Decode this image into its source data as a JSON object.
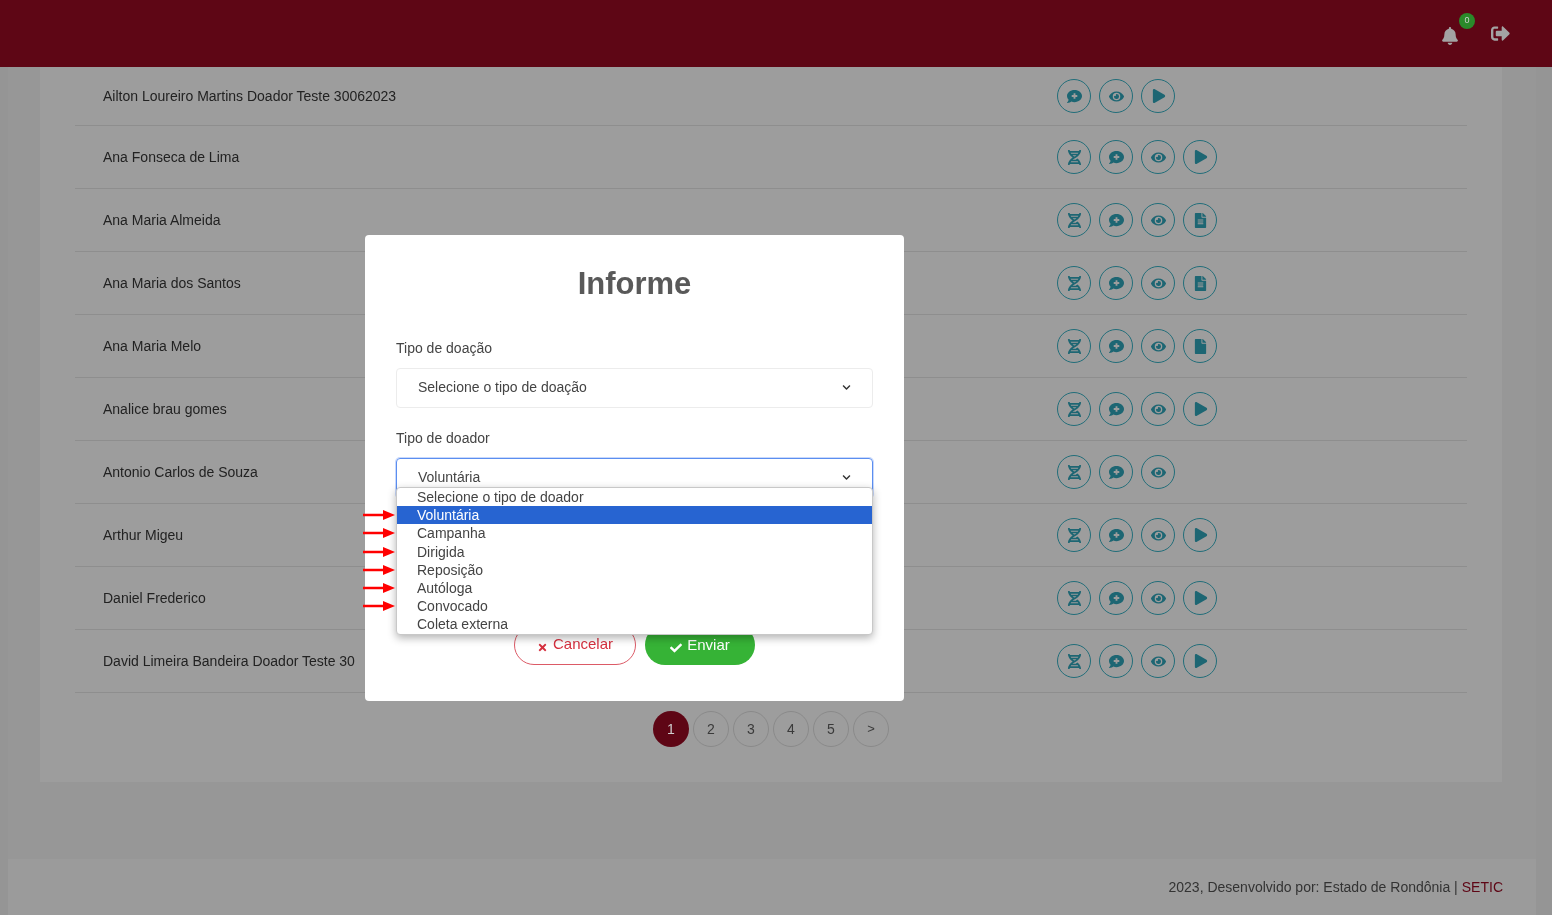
{
  "header": {
    "notification_count": "0"
  },
  "rows": [
    {
      "name": "Ailton Loureiro Martins Doador Teste 30062023",
      "actions": [
        {
          "kind": "comment"
        },
        {
          "kind": "view"
        },
        {
          "kind": "play"
        }
      ]
    },
    {
      "name": "Ana Fonseca de Lima",
      "actions": [
        {
          "kind": "dna"
        },
        {
          "kind": "comment"
        },
        {
          "kind": "view"
        },
        {
          "kind": "play"
        }
      ]
    },
    {
      "name": "Ana Maria Almeida",
      "actions": [
        {
          "kind": "dna"
        },
        {
          "kind": "comment"
        },
        {
          "kind": "view"
        },
        {
          "kind": "document"
        }
      ]
    },
    {
      "name": "Ana Maria dos Santos",
      "actions": [
        {
          "kind": "dna"
        },
        {
          "kind": "comment"
        },
        {
          "kind": "view"
        },
        {
          "kind": "document"
        }
      ]
    },
    {
      "name": "Ana Maria Melo",
      "actions": [
        {
          "kind": "dna"
        },
        {
          "kind": "comment"
        },
        {
          "kind": "view"
        },
        {
          "kind": "file"
        }
      ]
    },
    {
      "name": "Analice brau gomes",
      "actions": [
        {
          "kind": "dna"
        },
        {
          "kind": "comment"
        },
        {
          "kind": "view"
        },
        {
          "kind": "play"
        }
      ]
    },
    {
      "name": "Antonio Carlos de Souza",
      "actions": [
        {
          "kind": "dna"
        },
        {
          "kind": "comment"
        },
        {
          "kind": "view"
        }
      ]
    },
    {
      "name": "Arthur Migeu",
      "actions": [
        {
          "kind": "dna"
        },
        {
          "kind": "comment"
        },
        {
          "kind": "view"
        },
        {
          "kind": "play"
        }
      ]
    },
    {
      "name": "Daniel Frederico",
      "actions": [
        {
          "kind": "dna"
        },
        {
          "kind": "comment"
        },
        {
          "kind": "view"
        },
        {
          "kind": "play"
        }
      ]
    },
    {
      "name": "David Limeira Bandeira Doador Teste 30",
      "actions": [
        {
          "kind": "dna"
        },
        {
          "kind": "comment"
        },
        {
          "kind": "view"
        },
        {
          "kind": "play"
        }
      ]
    }
  ],
  "pagination": {
    "pages": [
      {
        "label": "1",
        "selected": true
      },
      {
        "label": "2",
        "selected": false
      },
      {
        "label": "3",
        "selected": false
      },
      {
        "label": "4",
        "selected": false
      },
      {
        "label": "5",
        "selected": false
      }
    ],
    "next": ">"
  },
  "modal": {
    "title": "Informe",
    "fields": [
      {
        "label": "Tipo de doação",
        "value": "Selecione o tipo de doação",
        "focused": false
      },
      {
        "label": "Tipo de doador",
        "value": "Voluntária",
        "focused": true
      }
    ],
    "dropdown_options": [
      {
        "label": "Selecione o tipo de doador",
        "selected": false,
        "marked": false
      },
      {
        "label": "Voluntária",
        "selected": true,
        "marked": true
      },
      {
        "label": "Campanha",
        "selected": false,
        "marked": true
      },
      {
        "label": "Dirigida",
        "selected": false,
        "marked": true
      },
      {
        "label": "Reposição",
        "selected": false,
        "marked": true
      },
      {
        "label": "Autóloga",
        "selected": false,
        "marked": true
      },
      {
        "label": "Convocado",
        "selected": false,
        "marked": true
      },
      {
        "label": "Coleta externa",
        "selected": false,
        "marked": false
      }
    ],
    "buttons": [
      {
        "kind": "cancel",
        "label": "Cancelar"
      },
      {
        "kind": "submit",
        "label": "Enviar"
      }
    ]
  },
  "footer": {
    "text": "2023, Desenvolvido por: Estado de Rondônia |",
    "link": "SETIC"
  }
}
